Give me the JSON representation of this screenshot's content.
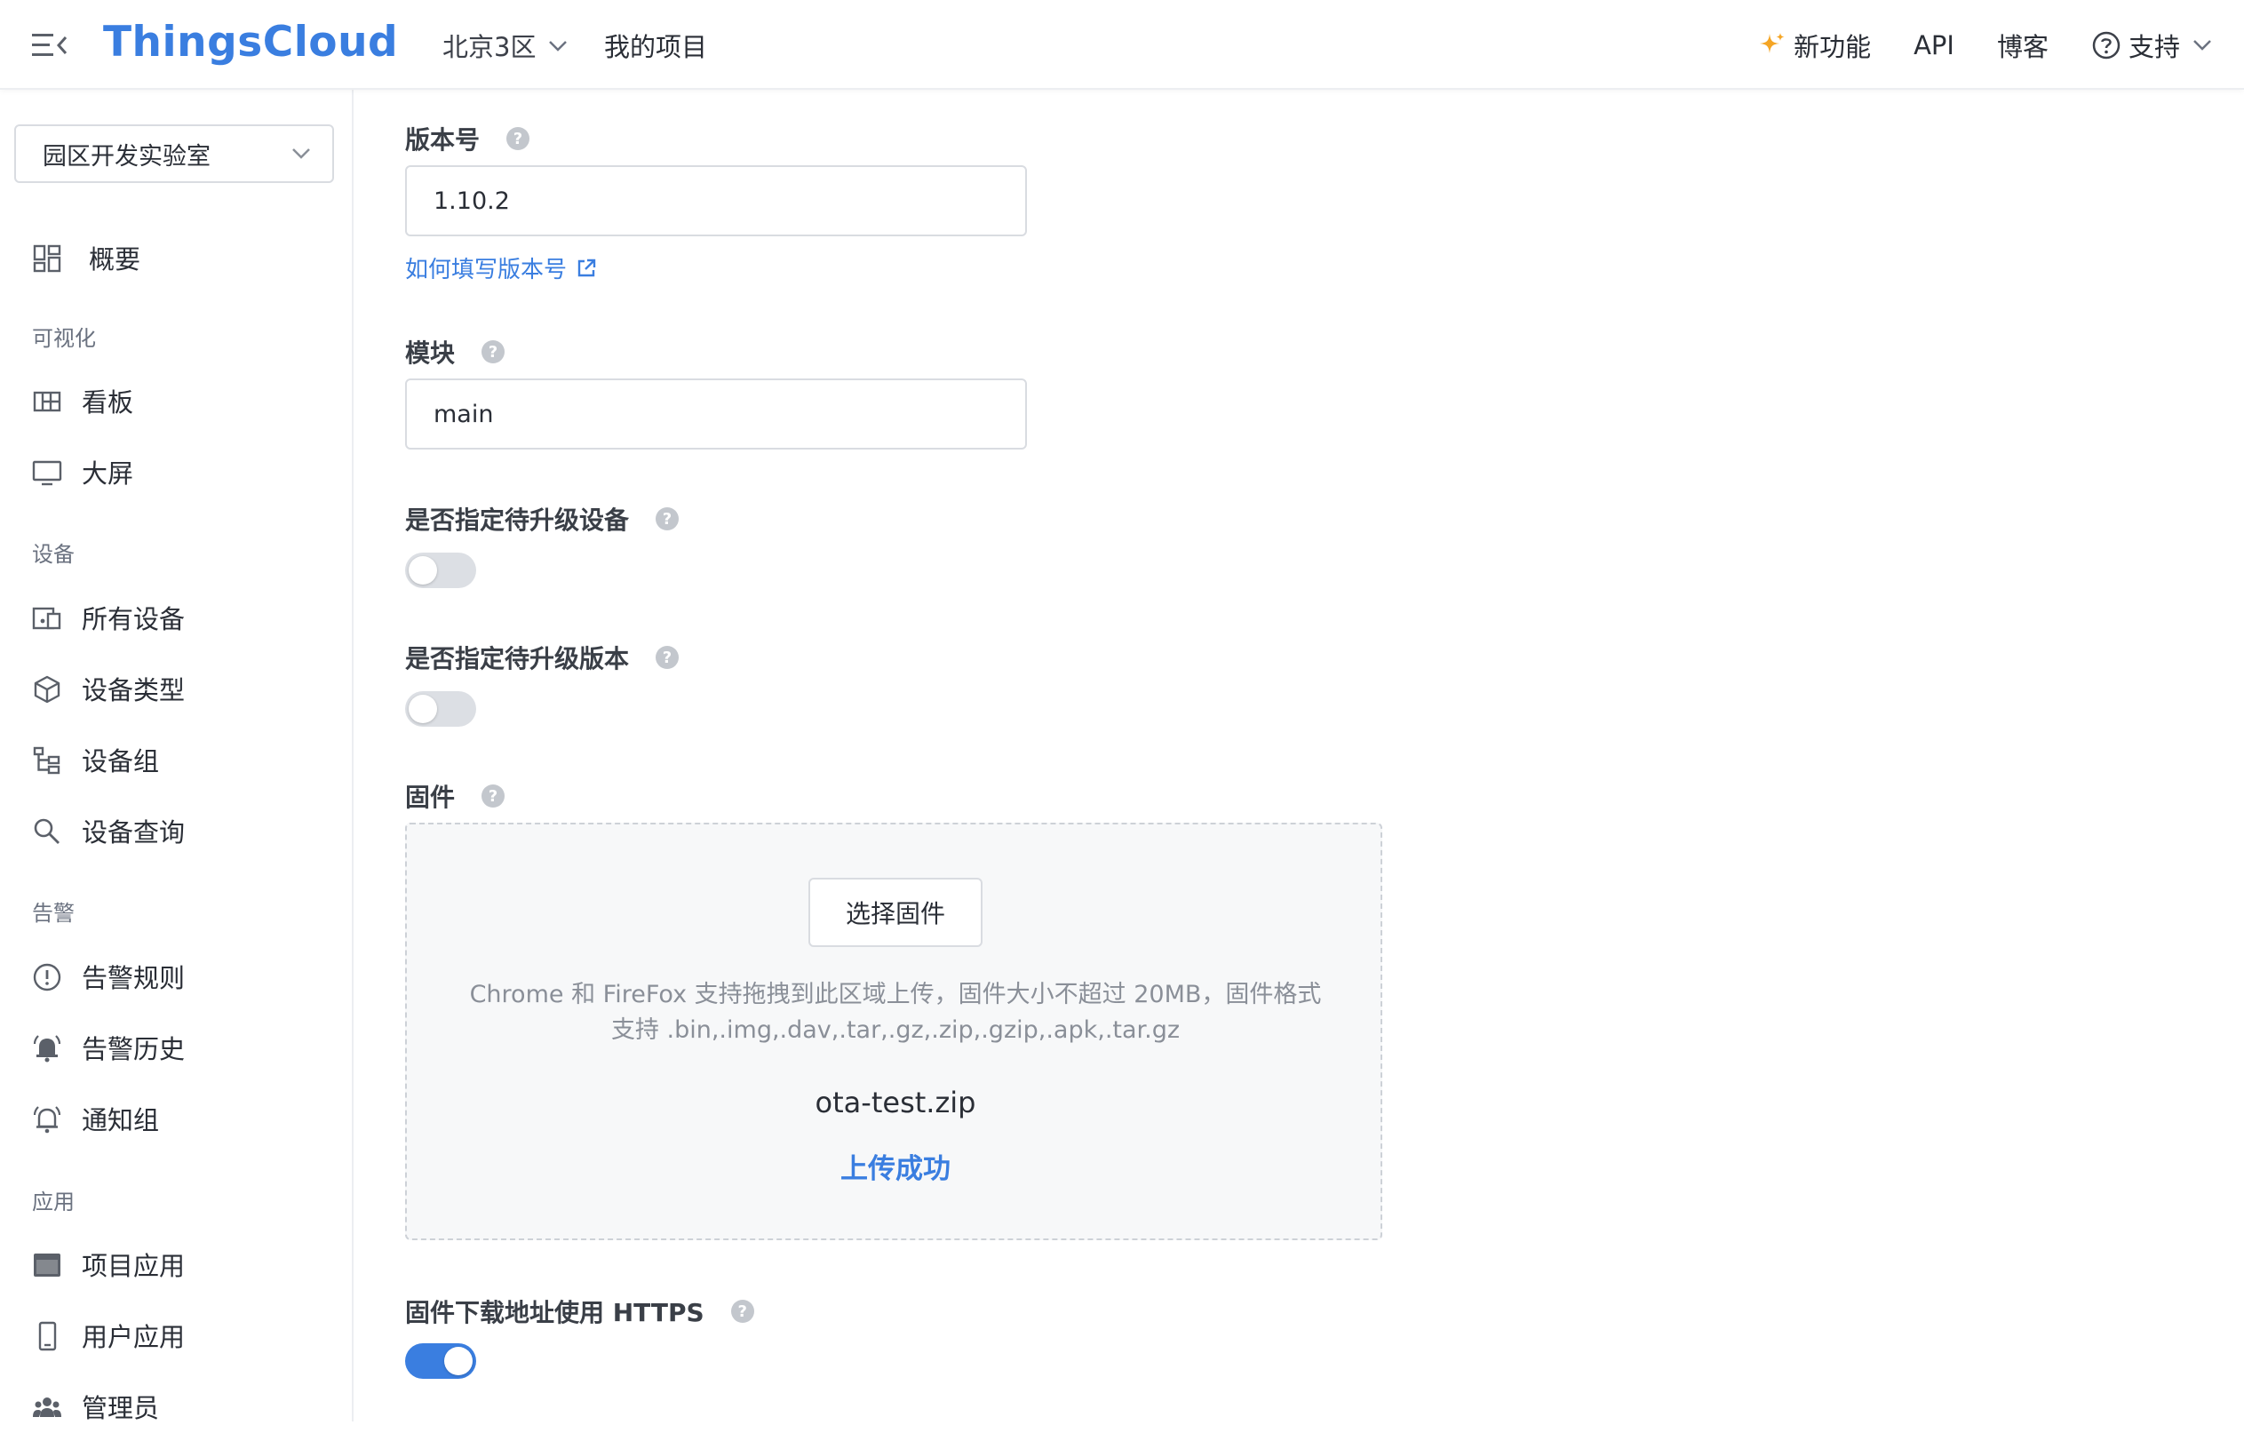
{
  "app": {
    "brand": "ThingsCloud"
  },
  "topbar": {
    "region": "北京3区",
    "my_projects": "我的项目",
    "new_features": "新功能",
    "api": "API",
    "blog": "博客",
    "support": "支持"
  },
  "sidebar": {
    "project": "园区开发实验室",
    "overview": "概要",
    "sections": {
      "visual": "可视化",
      "device": "设备",
      "alert": "告警",
      "app": "应用"
    },
    "items": {
      "dashboard": "看板",
      "bigscreen": "大屏",
      "all_devices": "所有设备",
      "device_types": "设备类型",
      "device_groups": "设备组",
      "device_query": "设备查询",
      "alert_rules": "告警规则",
      "alert_history": "告警历史",
      "notify_groups": "通知组",
      "project_apps": "项目应用",
      "user_apps": "用户应用",
      "admins": "管理员"
    }
  },
  "form": {
    "version_label": "版本号",
    "version_value": "1.10.2",
    "version_help_link": "如何填写版本号",
    "module_label": "模块",
    "module_value": "main",
    "specify_devices_label": "是否指定待升级设备",
    "specify_devices_on": false,
    "specify_version_label": "是否指定待升级版本",
    "specify_version_on": false,
    "firmware_label": "固件",
    "choose_firmware": "选择固件",
    "drop_hint": "Chrome 和 FireFox 支持拖拽到此区域上传，固件大小不超过 20MB，固件格式支持 .bin,.img,.dav,.tar,.gz,.zip,.gzip,.apk,.tar.gz",
    "file_name": "ota-test.zip",
    "upload_status": "上传成功",
    "https_label": "固件下载地址使用 HTTPS",
    "https_on": true
  },
  "colors": {
    "accent": "#3a7ee0",
    "spark": "#f5a524"
  }
}
